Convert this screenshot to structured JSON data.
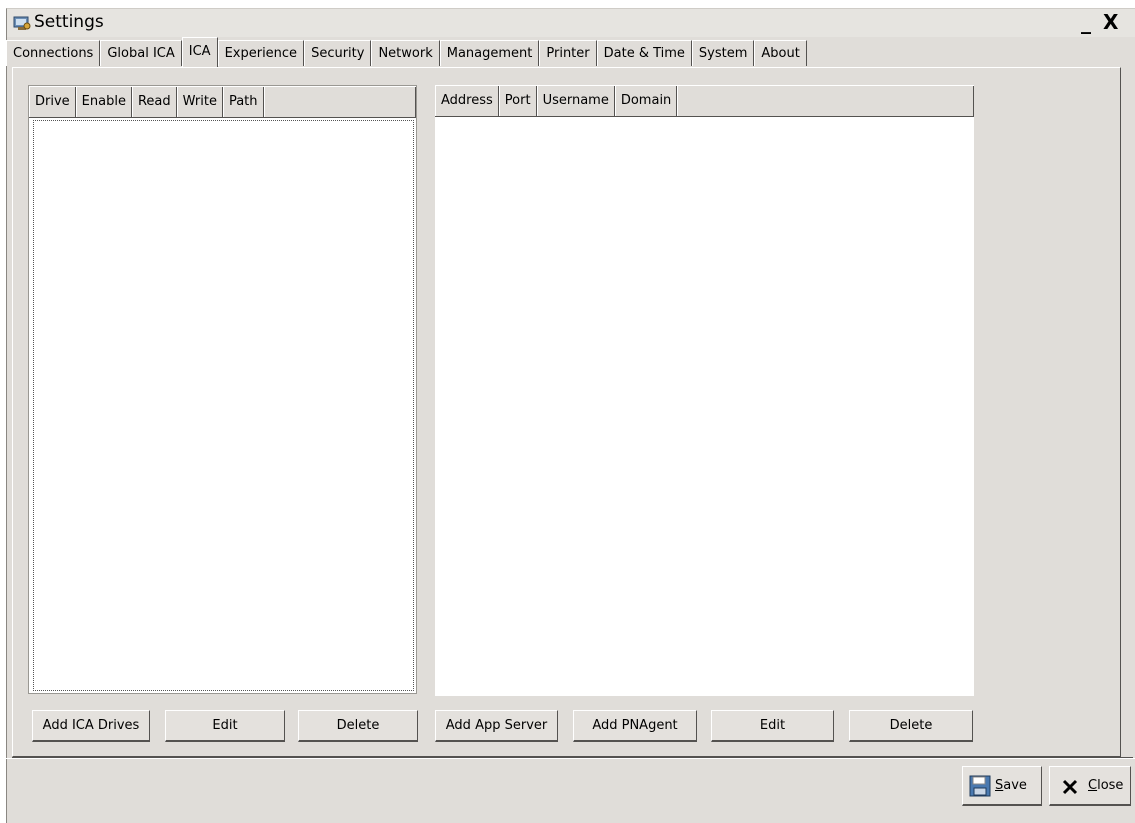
{
  "window": {
    "title": "Settings",
    "minimize_label": "_",
    "close_label": "X"
  },
  "tabs": [
    "Connections",
    "Global ICA",
    "ICA",
    "Experience",
    "Security",
    "Network",
    "Management",
    "Printer",
    "Date & Time",
    "System",
    "About"
  ],
  "active_tab": "ICA",
  "drives_list": {
    "columns": [
      "Drive",
      "Enable",
      "Read",
      "Write",
      "Path"
    ],
    "rows": []
  },
  "servers_list": {
    "columns": [
      "Address",
      "Port",
      "Username",
      "Domain"
    ],
    "rows": []
  },
  "drive_buttons": {
    "add": "Add ICA Drives",
    "edit": "Edit",
    "delete": "Delete"
  },
  "server_buttons": {
    "add_app_server": "Add App Server",
    "add_pnagent": "Add PNAgent",
    "edit": "Edit",
    "delete": "Delete"
  },
  "footer": {
    "save": {
      "underlined": "S",
      "rest": "ave",
      "icon": "floppy-disk-icon"
    },
    "close": {
      "underlined": "C",
      "rest": "lose",
      "icon": "x-icon"
    }
  }
}
